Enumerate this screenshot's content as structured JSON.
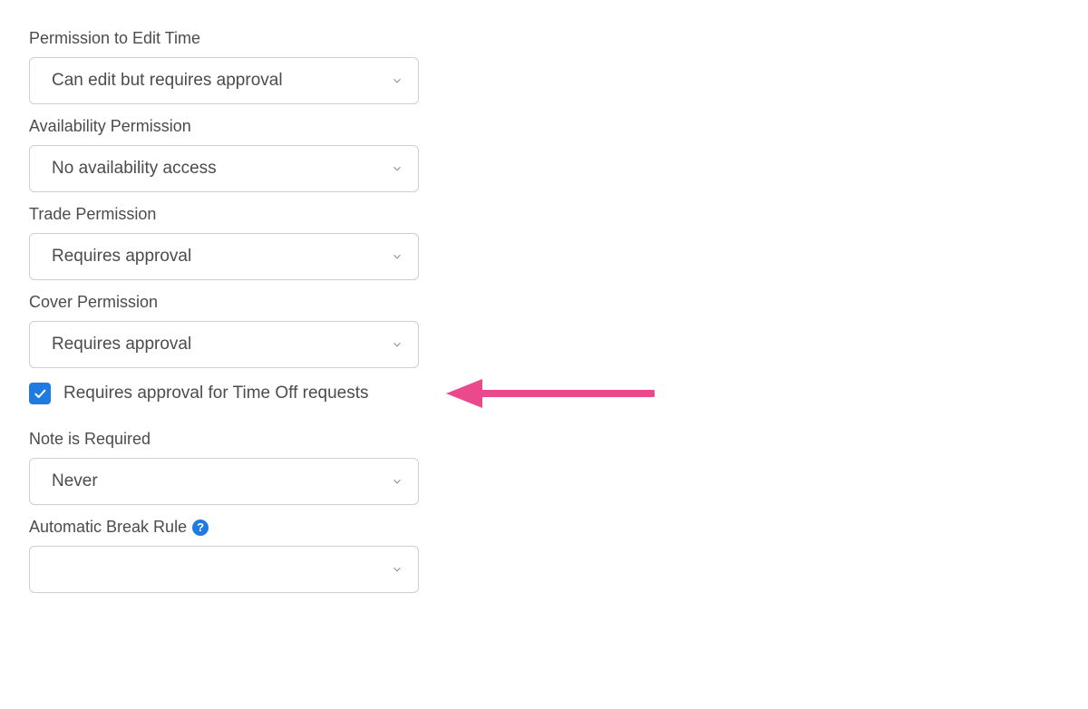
{
  "fields": {
    "edit_time": {
      "label": "Permission to Edit Time",
      "value": "Can edit but requires approval"
    },
    "availability": {
      "label": "Availability Permission",
      "value": "No availability access"
    },
    "trade": {
      "label": "Trade Permission",
      "value": "Requires approval"
    },
    "cover": {
      "label": "Cover Permission",
      "value": "Requires approval"
    },
    "time_off_checkbox": {
      "label": "Requires approval for Time Off requests",
      "checked": true
    },
    "note_required": {
      "label": "Note is Required",
      "value": "Never"
    },
    "break_rule": {
      "label": "Automatic Break Rule",
      "value": ""
    }
  },
  "help_glyph": "?",
  "colors": {
    "accent": "#1f7be0",
    "annotation": "#ea4a8b",
    "border": "#cfcfcf",
    "text": "#4c4c4c"
  }
}
